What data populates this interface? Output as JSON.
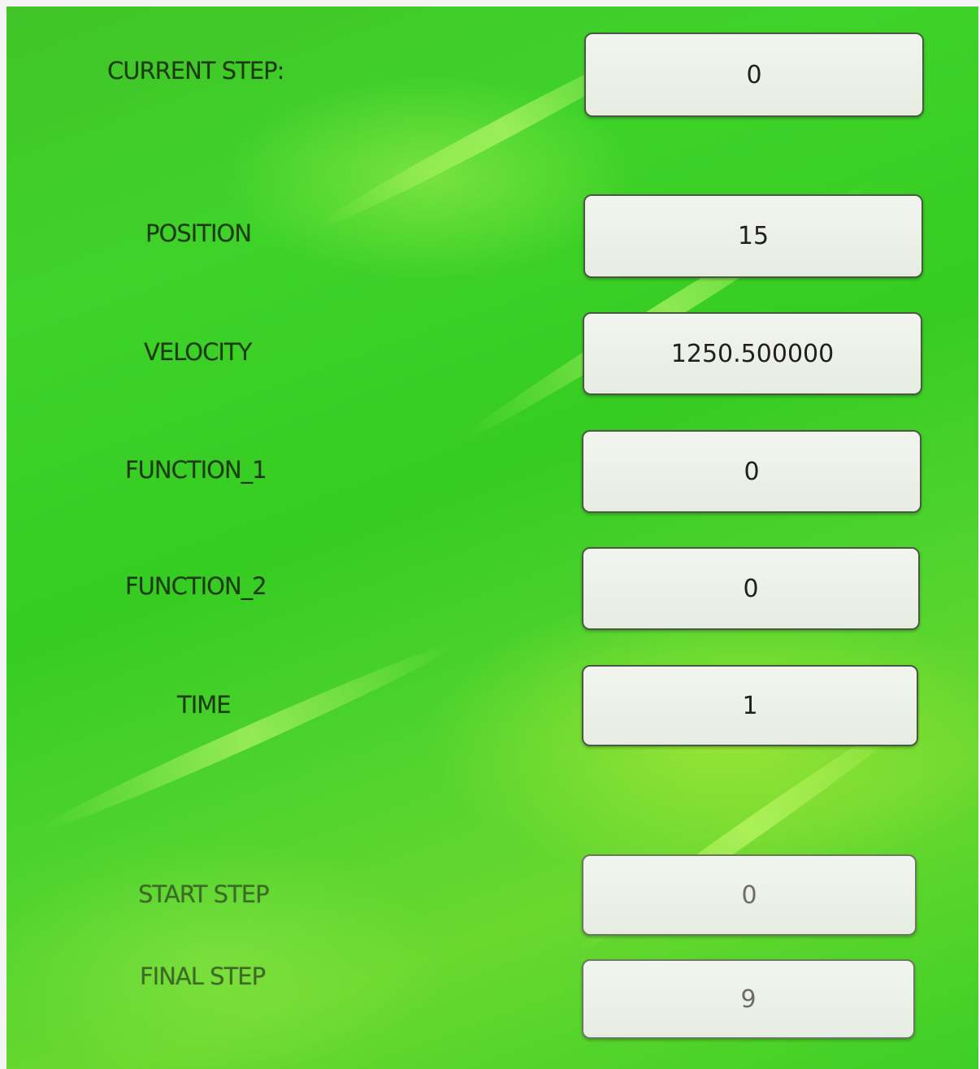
{
  "fields": [
    {
      "label": "CURRENT STEP:",
      "value": "0"
    },
    {
      "label": "POSITION",
      "value": "15"
    },
    {
      "label": "VELOCITY",
      "value": "1250.500000"
    },
    {
      "label": "FUNCTION_1",
      "value": "0"
    },
    {
      "label": "FUNCTION_2",
      "value": "0"
    },
    {
      "label": "TIME",
      "value": "1"
    },
    {
      "label": "START STEP",
      "value": "0"
    },
    {
      "label": "FINAL STEP",
      "value": "9"
    }
  ],
  "colors": {
    "background": "#3fd32a",
    "label_text": "#1e3a12",
    "field_background": "#eef1ea",
    "field_border": "#4a5a40"
  }
}
